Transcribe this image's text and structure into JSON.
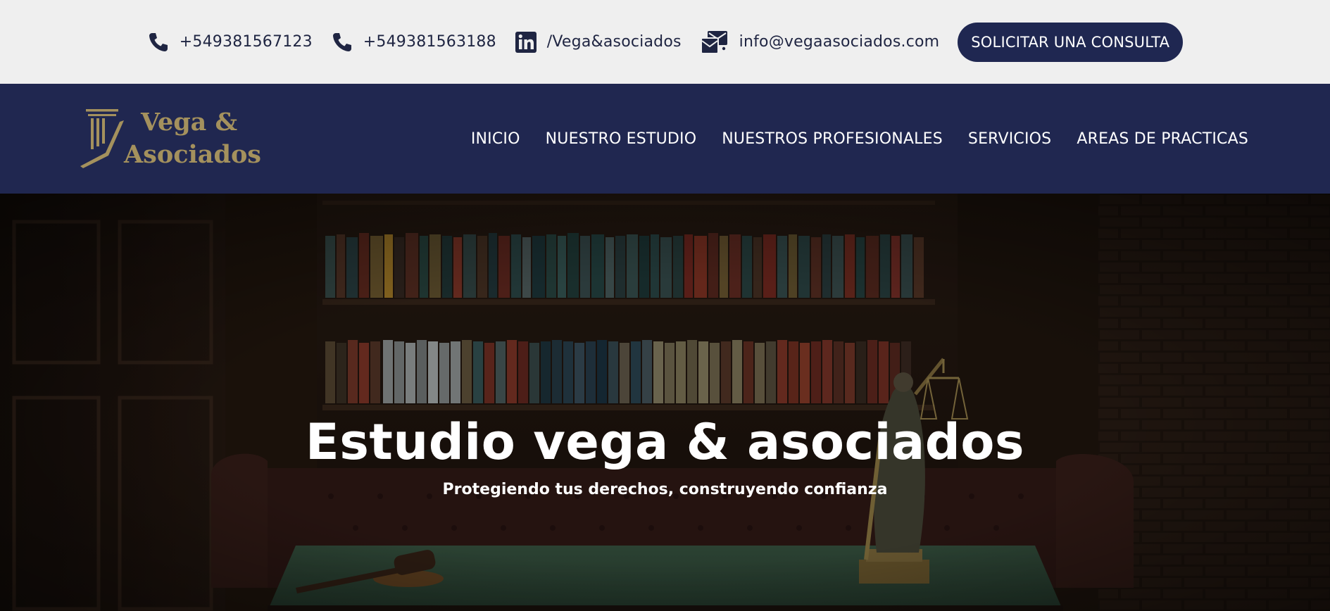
{
  "topbar": {
    "phone1": "+549381567123",
    "phone2": "+549381563188",
    "linkedin": "/Vega&asociados",
    "email": "info@vegaasociados.com",
    "cta_label": "SOLICITAR UNA CONSULTA",
    "icons": [
      "phone-icon",
      "phone-icon",
      "linkedin-icon",
      "email-icon"
    ]
  },
  "brand": {
    "line1": "Vega &",
    "line2": "Asociados",
    "gold": "#a4915d",
    "navy": "#202750"
  },
  "nav": {
    "items": [
      "INICIO",
      "NUESTRO ESTUDIO",
      "NUESTROS PROFESIONALES",
      "SERVICIOS",
      "AREAS DE PRACTICAS"
    ]
  },
  "hero": {
    "title": "Estudio vega & asociados",
    "subtitle": "Protegiendo tus derechos, construyendo confianza"
  }
}
